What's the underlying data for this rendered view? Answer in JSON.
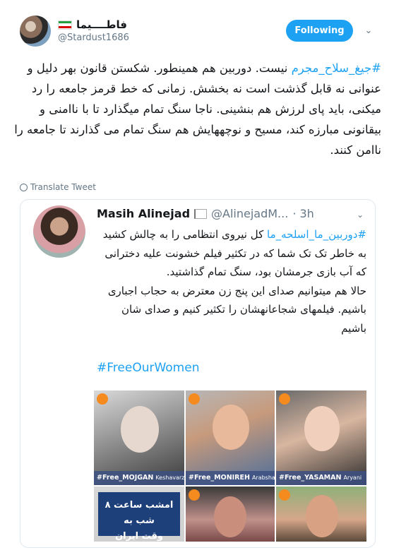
{
  "author": {
    "display_name": "فاطــــیما",
    "handle": "@Stardust1686",
    "flag_colors": [
      "#239f40",
      "#ffffff",
      "#da0000"
    ]
  },
  "follow_button": {
    "label": "Following",
    "color": "#1da1f2"
  },
  "tweet": {
    "hashtag": "#جیغ_سلاح_مجرم",
    "body": " نیست. دوربین هم همینطور. شکستن قانون بهر دلیل و عنوانی نه قابل گذشت است نه بخشش. زمانی که خط قرمز جامعه را رد میکنی، باید پای لرزش هم بنشینی. ناجا سنگ تمام میگذارد تا با ناامنی و بیقانونی مبارزه کند، مسیح و نوچههایش هم سنگ تمام می گذارند تا جامعه را ناامن کنند.",
    "translate_label": "Translate Tweet"
  },
  "quoted_tweet": {
    "name": "Masih Alinejad",
    "handle": "@AlinejadM...",
    "time": "· 3h",
    "hashtag": "#دوربین_ما_اسلحه_ما",
    "body_line1": " کل نیروی انتظامی را به چالش کشید به خاطر تک تک شما که در تکثیر فیلم خشونت علیه دخترانی که آب بازی جرمشان بود، سنگ تمام گذاشتید.",
    "body_line2": "حالا هم میتوانیم صدای این پنج زن معترض به حجاب اجباری باشیم. فیلمهای شجاعانهشان را تکثیر کنیم و صدای شان باشیم",
    "free_tag": "#FreeOurWomen",
    "collage": {
      "people": [
        {
          "tag": "#Free_MOJGAN",
          "surname": "Keshavarz"
        },
        {
          "tag": "#Free_MONIREH",
          "surname": "Arabshahi"
        },
        {
          "tag": "#Free_YASAMAN",
          "surname": "Aryani"
        }
      ],
      "time_notice_line1": "امشب ساعت ۸ شب به",
      "time_notice_line2": "وقت ایران"
    }
  },
  "icons": {
    "chevron": "chevron-down-icon",
    "globe": "globe-icon",
    "badge": "logo-badge-icon",
    "flag": "white-flag-icon"
  }
}
